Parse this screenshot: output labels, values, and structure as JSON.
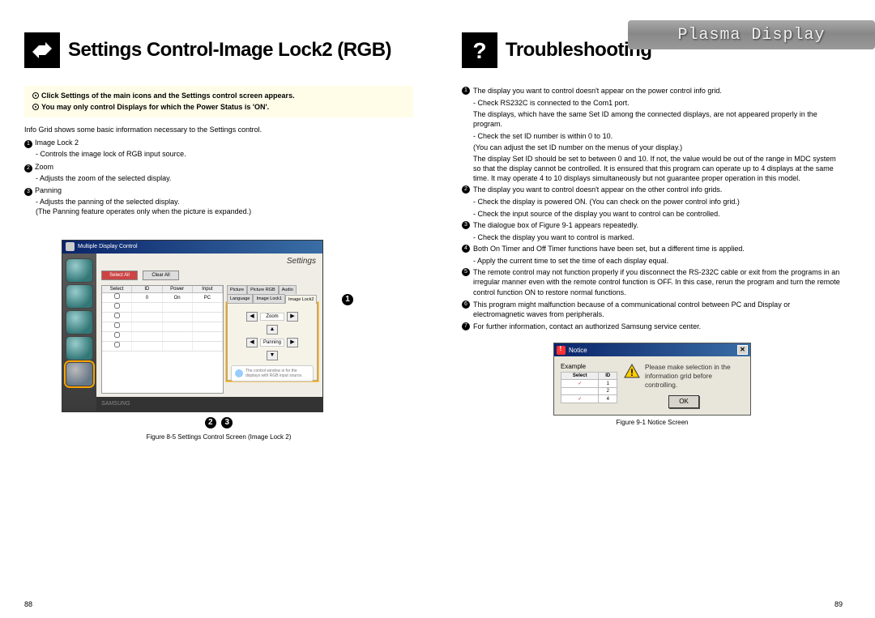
{
  "header_brand": "Plasma Display",
  "left": {
    "title": "Settings Control-Image Lock2 (RGB)",
    "note_line1": "Click Settings of the main icons and the Settings control screen appears.",
    "note_line2": "You may only control Displays for which the Power Status is 'ON'.",
    "intro": "Info Grid shows some basic information necessary to the Settings control.",
    "items": [
      {
        "n": "1",
        "label": "Image Lock 2",
        "sub": "- Controls the image lock of RGB input source."
      },
      {
        "n": "2",
        "label": "Zoom",
        "sub": "- Adjusts the zoom of the selected display."
      },
      {
        "n": "3",
        "label": "Panning",
        "sub": "- Adjusts the panning of the selected display.\n(The Panning feature operates only when the picture is expanded.)"
      }
    ],
    "app": {
      "title": "Multiple Display Control",
      "section": "Settings",
      "btn_select_all": "Select All",
      "btn_clear_all": "Clear All",
      "grid_headers": [
        "Select",
        "ID",
        "Power",
        "Input"
      ],
      "grid_row": [
        "",
        "0",
        "On",
        "PC"
      ],
      "tabs": [
        "Picture",
        "Picture RGB",
        "Audio",
        "Language",
        "Image Lock1",
        "Image Lock2"
      ],
      "zoom_label": "Zoom",
      "panning_label": "Panning",
      "info_text": "The control window is for the displays with RGB input source."
    },
    "callout1": "1",
    "callout2": "2",
    "callout3": "3",
    "fig_caption": "Figure 8-5 Settings Control Screen (Image Lock 2)",
    "page_no": "88"
  },
  "right": {
    "title": "Troubleshooting",
    "items": [
      {
        "n": "1",
        "text": "The display you want to control doesn't appear on the power control info grid.",
        "subs": [
          "- Check RS232C is connected to the Com1 port.",
          "The displays, which have the same Set ID among the connected displays, are not appeared properly in the program.",
          "- Check the set ID number is within 0 to 10.",
          "(You can adjust the set ID number on the menus of your display.)",
          "The display Set ID should be set to between 0 and 10. If not, the value would be out of the range in MDC system so that the display cannot be controlled. It is ensured that this program can operate up to 4 displays at the same time. It may operate 4 to 10 displays simultaneously but not guarantee proper operation in this model."
        ]
      },
      {
        "n": "2",
        "text": "The display you want to control doesn't appear on the other control info grids.",
        "subs": [
          "- Check the display is powered ON. (You can check on the power control info grid.)",
          "- Check the input source of the display you want to control can be controlled."
        ]
      },
      {
        "n": "3",
        "text": "The dialogue box of Figure 9-1 appears repeatedly.",
        "subs": [
          "- Check the display you want to control is marked."
        ]
      },
      {
        "n": "4",
        "text": "Both On Timer and Off Timer functions have been set, but a different time is applied.",
        "subs": [
          "- Apply the current time to set the time of each display equal."
        ]
      },
      {
        "n": "5",
        "text": "The remote control may not function properly if you disconnect the RS-232C cable or exit from the programs in an irregular manner even with the remote control function is OFF. In this case, rerun the program and turn the remote control function ON to restore normal functions.",
        "subs": []
      },
      {
        "n": "6",
        "text": "This program might malfunction because of a communicational control between PC and Display or electromagnetic waves from peripherals.",
        "subs": []
      },
      {
        "n": "7",
        "text": "For further information, contact an authorized Samsung service center.",
        "subs": []
      }
    ],
    "notice": {
      "title": "Notice",
      "example": "Example",
      "grid_h1": "Select",
      "grid_h2": "ID",
      "rows": [
        [
          "✓",
          "1"
        ],
        [
          "",
          "2"
        ],
        [
          "✓",
          "4"
        ]
      ],
      "msg": "Please make selection in the information grid before controlling.",
      "ok": "OK",
      "caption": "Figure 9-1 Notice Screen"
    },
    "page_no": "89"
  }
}
